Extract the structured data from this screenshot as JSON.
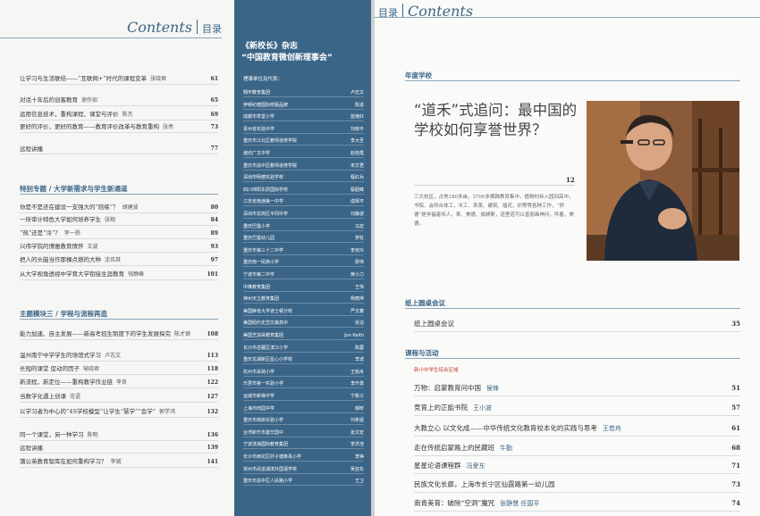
{
  "left": {
    "header": {
      "en": "Contents",
      "zh": "目录"
    },
    "group1": [
      {
        "title": "让学习与生活联结——“互联网+”时代的课程变革",
        "author": "张晓君",
        "page": "61"
      },
      {
        "title": "对话十年后的创客教育",
        "author": "谢作如",
        "page": "65"
      },
      {
        "title": "运用信息技术，重构课程、课堂与评价",
        "author": "陈杰",
        "page": "69"
      },
      {
        "title": "更好的评价，更好的教育——教育评价改革与教育重构",
        "author": "张亮",
        "page": "73"
      },
      {
        "title": "远程讲播",
        "author": "",
        "page": "77"
      }
    ],
    "section1": "特别专题 / 大学新需求与学生新通道",
    "group2": [
      {
        "title": "你是不是还在建设一支强大的“陪练”？",
        "author": "胡建波",
        "page": "80"
      },
      {
        "title": "一所审计特色大学如何培养学生",
        "author": "张翔",
        "page": "84"
      },
      {
        "title": "“热”还是“冷”？",
        "author": "李一扬",
        "page": "89"
      },
      {
        "title": "兴伟学院的博雅教育情怀",
        "author": "文波",
        "page": "93"
      },
      {
        "title": "把人的头脑当作那棵点燃的大种",
        "author": "沈伟其",
        "page": "97"
      },
      {
        "title": "从大学视角透视中学育大学衔接生涯教育",
        "author": "钱静峰",
        "page": "101"
      }
    ],
    "section2": "主题模块三 / 学程与流程再造",
    "group3": [
      {
        "title": "能力加速、自主发展——新高考招生制度下的学生发展探究",
        "author": "陈才锜",
        "page": "108"
      },
      {
        "title": "温州南宁中学学生的场馆式学习",
        "author": "卢志文",
        "page": "113"
      },
      {
        "title": "长短的课堂 促动的因子",
        "author": "喻晓君",
        "page": "118"
      },
      {
        "title": "新流程，新定位——重构教学作业链",
        "author": "李良",
        "page": "122"
      },
      {
        "title": "当数学化遇上创课",
        "author": "花语",
        "page": "127"
      },
      {
        "title": "以学习者为中心的“4S学校模型”让学生“慧学”“会学”",
        "author": "郭学鸿",
        "page": "132"
      },
      {
        "title": "同一个课堂，另一种学习",
        "author": "陈明",
        "page": "136"
      },
      {
        "title": "远程讲播",
        "author": "",
        "page": "139"
      },
      {
        "title": "蒲公英教育智库在如何重构学习？",
        "author": "李斌",
        "page": "141"
      }
    ]
  },
  "middle": {
    "title1": "《新校长》杂志",
    "title2": "“中国教育微创新理事会”",
    "subtitle": "理事单位及代表：",
    "members": [
      {
        "unit": "翔宇教育集团",
        "name": "卢志文"
      },
      {
        "unit": "伊顿纪德国际校服品牌",
        "name": "陈进"
      },
      {
        "unit": "成都市草堂小学",
        "name": "蓝继红"
      },
      {
        "unit": "贵州省实验中学",
        "name": "刘晓平"
      },
      {
        "unit": "重庆市江北区教师进修学院",
        "name": "李大圣"
      },
      {
        "unit": "潍坊广文中学",
        "name": "赵桂霞"
      },
      {
        "unit": "重庆市渝中区教师进修学院",
        "name": "宋文君"
      },
      {
        "unit": "深圳市明德实验学校",
        "name": "程红兵"
      },
      {
        "unit": "四川绵阳东辰国际学校",
        "name": "蔡韶峰"
      },
      {
        "unit": "江苏省南通第一中学",
        "name": "成晖平"
      },
      {
        "unit": "深圳市龙岗区平冈中学",
        "name": "刘静波"
      },
      {
        "unit": "重庆巴蜀小学",
        "name": "马宏"
      },
      {
        "unit": "重庆巴蜀幼儿园",
        "name": "罗虹"
      },
      {
        "unit": "重庆市第三十二中学",
        "name": "李宪玲"
      },
      {
        "unit": "重庆南一民族小学",
        "name": "廖伟"
      },
      {
        "unit": "宁波市第二中学",
        "name": "黄小力"
      },
      {
        "unit": "中推教育集团",
        "name": "王伟"
      },
      {
        "unit": "神州天立教育集团",
        "name": "杨丽萍"
      },
      {
        "unit": "美国麻省大学波士顿分校",
        "name": "严文蕃"
      },
      {
        "unit": "美国纽约史岱文森高中",
        "name": "张浴"
      },
      {
        "unit": "美国芝加哥教育集团",
        "name": "Jon Keith"
      },
      {
        "unit": "长沙市岳麓区滨江小学",
        "name": "陈蓉"
      },
      {
        "unit": "重庆龙湖新区星心小学校",
        "name": "李波"
      },
      {
        "unit": "杭州市采荷小学",
        "name": "王崧舟"
      },
      {
        "unit": "乐居市第一实验小学",
        "name": "李升勇"
      },
      {
        "unit": "运城市新绛中学",
        "name": "宁致义"
      },
      {
        "unit": "上海市田园中学",
        "name": "郁昕"
      },
      {
        "unit": "重庆市南岸实验小学",
        "name": "刘希娅"
      },
      {
        "unit": "台湾新竹市建华国中",
        "name": "张文宏"
      },
      {
        "unit": "宁波滨海国际教育集团",
        "name": "李洪浩"
      },
      {
        "unit": "长沙市雨花区砂子塘泰禹小学",
        "name": "李铮"
      },
      {
        "unit": "常州市武进湖滨外国语学校",
        "name": "吴亚东"
      },
      {
        "unit": "重庆市渝中区人民路小学",
        "name": "王卫"
      }
    ]
  },
  "right": {
    "header": {
      "zh": "目录",
      "en": "Contents"
    },
    "section1": "年度学校",
    "feature": {
      "title": "“道禾”式追问：最中国的学校如何享誉世界？",
      "page": "12",
      "summary": "三大校区，占地180多亩，3700多横跨教育集中，植物村丝入园到高中，书院、会所合体工，木工、卖茶、建筑、插花、织等等各种工作，“师德”是学福者传人，茶、美德、成绩斯，道里道可以富丽画神问，呼着，美德。"
    },
    "section2": "纸上圆桌会议",
    "group2": [
      {
        "title": "纸上圆桌会议",
        "author": "",
        "page": "35"
      }
    ],
    "section3": "课程与活动",
    "subsection": "新小中学生综合区域",
    "group3": [
      {
        "title": "万物：启蒙教育问中国",
        "author": "侯锋",
        "page": "51"
      },
      {
        "title": "竞育上的正能书院",
        "author": "王小波",
        "page": "57"
      },
      {
        "title": "大教立心 以文化成——中华传统文化教育校本化的实践与思考",
        "author": "王若舟",
        "page": "61"
      },
      {
        "title": "走在传统启蒙路上的民藏班",
        "author": "牛勤",
        "page": "68"
      },
      {
        "title": "星星论语课程群",
        "author": "冯爱东",
        "page": "71"
      },
      {
        "title": "民族文化长廊，上海市长宁区仙霞路第一幼儿园",
        "author": "",
        "page": "73"
      },
      {
        "title": "南青美育：破除“空洞”魔咒",
        "author": "张静慧 任国平",
        "page": "74"
      }
    ]
  }
}
